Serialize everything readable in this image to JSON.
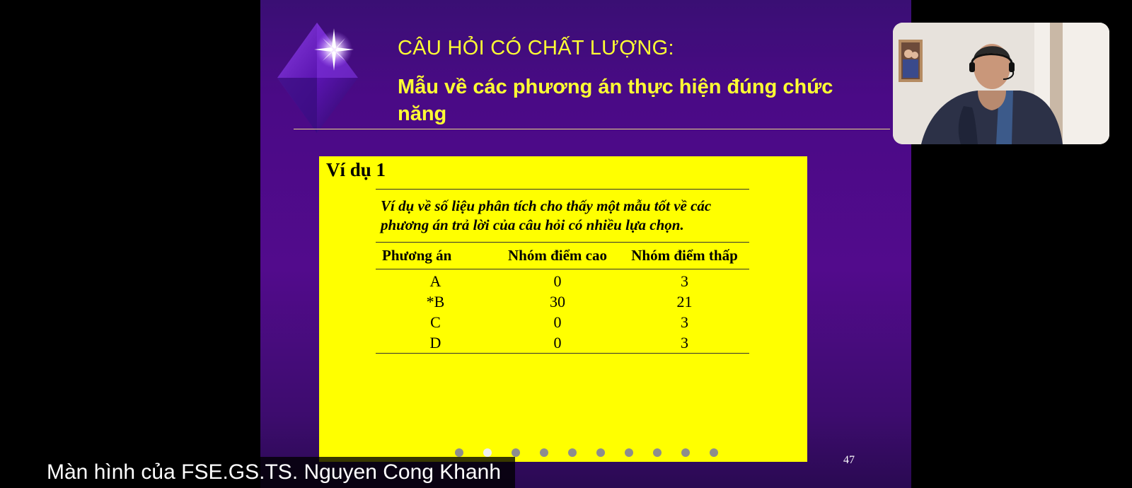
{
  "slide": {
    "title_line1": "CÂU HỎI CÓ CHẤT LƯỢNG:",
    "title_line2": "Mẫu về các phương án thực hiện đúng chức năng",
    "example_heading": "Ví dụ 1",
    "example_caption": "Ví dụ về số liệu phân tích cho thấy một mẫu tốt về các phương án trả lời của câu hỏi có nhiều lựa chọn.",
    "table": {
      "headers": [
        "Phương án",
        "Nhóm điểm cao",
        "Nhóm điểm thấp"
      ],
      "rows": [
        [
          "A",
          "0",
          "3"
        ],
        [
          "*B",
          "30",
          "21"
        ],
        [
          "C",
          "0",
          "3"
        ],
        [
          "D",
          "0",
          "3"
        ]
      ]
    },
    "page_number": "47",
    "colors": {
      "title": "#ffff33",
      "box": "#ffff00",
      "background": "#4a0a86"
    }
  },
  "pager": {
    "total": 10,
    "active_index": 1
  },
  "presenter_caption": "Màn hình của FSE.GS.TS. Nguyen Cong Khanh",
  "icons": [
    "diamond-star-icon",
    "pager-dot-icon",
    "webcam-video-icon"
  ]
}
